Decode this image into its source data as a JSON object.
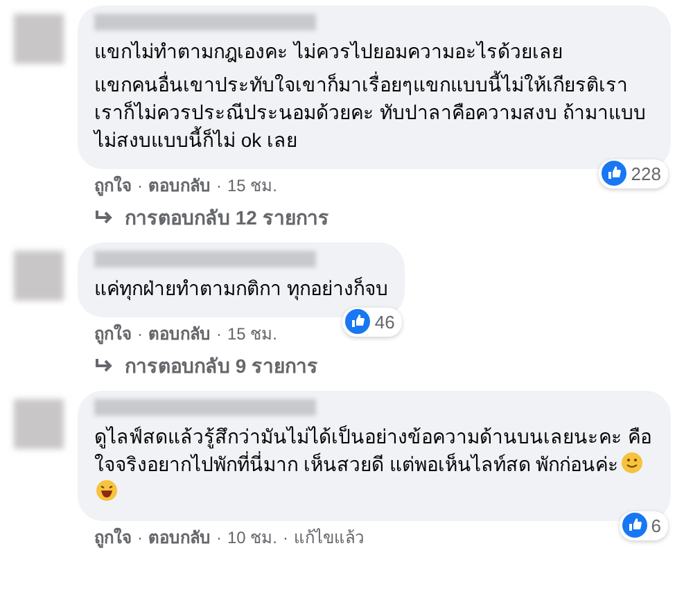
{
  "comments": [
    {
      "body": [
        "แขกไม่ทำตามกฎเองคะ ไม่ควรไปยอมความอะไรด้วยเลย",
        "แขกคนอื่นเขาประทับใจเขาก็มาเรื่อยๆแขกแบบนี้ไม่ให้เกียรติเรา เราก็ไม่ควรประณีประนอมด้วยคะ ทับปาลาคือความสงบ ถ้ามาแบบไม่สงบแบบนี้ก็ไม่ ok เลย"
      ],
      "reaction_count": "228",
      "like": "ถูกใจ",
      "separator": "·",
      "reply": "ตอบกลับ",
      "time": "15 ชม.",
      "replies": "การตอบกลับ 12 รายการ"
    },
    {
      "body": [
        "แค่ทุกฝ่ายทำตามกติกา ทุกอย่างก็จบ"
      ],
      "reaction_count": "46",
      "like": "ถูกใจ",
      "separator": "·",
      "reply": "ตอบกลับ",
      "time": "15 ชม.",
      "replies": "การตอบกลับ 9 รายการ"
    },
    {
      "body": [
        "ดูไลฟ์สดแล้วรู้สึกว่ามันไม่ได้เป็นอย่างข้อความด้านบนเลยนะคะ คือใจจริงอยากไปพักที่นี่มาก เห็นสวยดี แต่พอเห็นไลท์สด พักก่อนค่ะ"
      ],
      "emojis": [
        {
          "kind": "smile"
        },
        {
          "kind": "laugh"
        }
      ],
      "reaction_count": "6",
      "like": "ถูกใจ",
      "separator": "·",
      "reply": "ตอบกลับ",
      "time": "10 ชม.",
      "edited": "แก้ไขแล้ว"
    }
  ]
}
